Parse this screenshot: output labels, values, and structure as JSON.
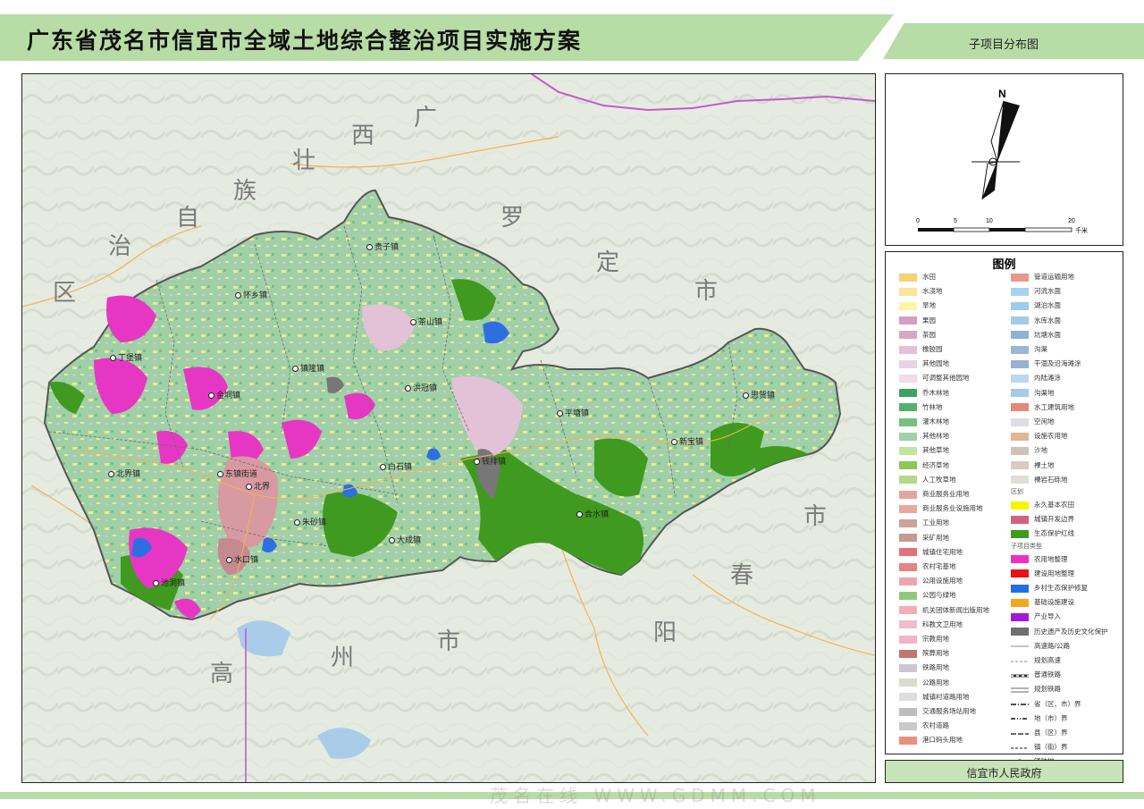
{
  "header": {
    "title": "广东省茂名市信宜市全域土地综合整治项目实施方案",
    "subtitle": "子项目分布图"
  },
  "map": {
    "province_labels": [
      {
        "text": "广"
      },
      {
        "text": "西"
      },
      {
        "text": "壮"
      },
      {
        "text": "族"
      },
      {
        "text": "自"
      },
      {
        "text": "治"
      },
      {
        "text": "区"
      },
      {
        "text": "罗"
      },
      {
        "text": "定"
      },
      {
        "text": "市"
      },
      {
        "text": "市"
      },
      {
        "text": "春"
      },
      {
        "text": "阳"
      },
      {
        "text": "市"
      },
      {
        "text": "州"
      },
      {
        "text": "高"
      }
    ],
    "towns": [
      {
        "name": "钱排镇"
      },
      {
        "name": "合水镇"
      },
      {
        "name": "白石镇"
      },
      {
        "name": "洪冠镇"
      },
      {
        "name": "金垌镇"
      },
      {
        "name": "北界镇"
      },
      {
        "name": "怀乡镇"
      },
      {
        "name": "新宝镇"
      },
      {
        "name": "茶山镇"
      },
      {
        "name": "平塘镇"
      },
      {
        "name": "贵子镇"
      },
      {
        "name": "思贺镇"
      },
      {
        "name": "东镇街道"
      },
      {
        "name": "丁堡镇"
      },
      {
        "name": "朱砂镇"
      },
      {
        "name": "水口镇"
      },
      {
        "name": "镇隆镇"
      },
      {
        "name": "大成镇"
      },
      {
        "name": "池洞镇"
      },
      {
        "name": "北界"
      }
    ],
    "colors": {
      "background": "#e7ece4",
      "forest": "#9fd0a8",
      "protected": "#3f9a1f",
      "farmland": "#f2e88c",
      "reclaim": "#e637c4",
      "urban": "#d79aa0",
      "water": "#2e6fe0",
      "mining": "#777777",
      "road": "#f5b253",
      "boundary": "#6a6a6a",
      "province_road": "#c45ac9"
    }
  },
  "compass": {
    "north_label": "N",
    "scale_labels": [
      "0",
      "5",
      "10",
      "20"
    ],
    "scale_unit": "千米"
  },
  "legend": {
    "title": "图例",
    "left_items": [
      {
        "label": "水田",
        "color": "#f6cf78"
      },
      {
        "label": "水浇地",
        "color": "#fbe49c"
      },
      {
        "label": "旱地",
        "color": "#fcf4a8"
      },
      {
        "label": "果园",
        "color": "#d59fc4"
      },
      {
        "label": "茶园",
        "color": "#d8a7c2"
      },
      {
        "label": "橡胶园",
        "color": "#e3c2d8"
      },
      {
        "label": "其他园地",
        "color": "#ead1e4"
      },
      {
        "label": "可调整其他园地",
        "color": "#f0dcea"
      },
      {
        "label": "乔木林地",
        "color": "#3aa360"
      },
      {
        "label": "竹林地",
        "color": "#56b06c"
      },
      {
        "label": "灌木林地",
        "color": "#78c081"
      },
      {
        "label": "其他林地",
        "color": "#9fd0a8"
      },
      {
        "label": "其他草地",
        "color": "#c4e4a1"
      },
      {
        "label": "经济草地",
        "color": "#8fc85a"
      },
      {
        "label": "人工牧草地",
        "color": "#b2d98b"
      },
      {
        "label": "商业服务业用地",
        "color": "#e3a69c"
      },
      {
        "label": "商业服务业设施用地",
        "color": "#e8a89d"
      },
      {
        "label": "工业用地",
        "color": "#caa49c"
      },
      {
        "label": "采矿用地",
        "color": "#c69a90"
      },
      {
        "label": "城镇住宅用地",
        "color": "#e2737a"
      },
      {
        "label": "农村宅基地",
        "color": "#e5857d"
      },
      {
        "label": "公用设施用地",
        "color": "#eda5ad"
      },
      {
        "label": "公园与绿地",
        "color": "#8fc97b"
      },
      {
        "label": "机关团体新闻出版用地",
        "color": "#f1aeb8"
      },
      {
        "label": "科教文卫用地",
        "color": "#f0bccb"
      },
      {
        "label": "宗教用地",
        "color": "#f2b4c6"
      },
      {
        "label": "殡葬用地",
        "color": "#c0776f"
      },
      {
        "label": "铁路用地",
        "color": "#cec4d3"
      },
      {
        "label": "公路用地",
        "color": "#d7dccd"
      },
      {
        "label": "城镇村道路用地",
        "color": "#dedede"
      },
      {
        "label": "交通服务场站用地",
        "color": "#bdbdbd"
      },
      {
        "label": "农村道路",
        "color": "#c9c9c9"
      },
      {
        "label": "港口码头用地",
        "color": "#e9907e"
      }
    ],
    "right_items": [
      {
        "label": "管道运输用地",
        "color": "#e9988e"
      },
      {
        "label": "河流水面",
        "color": "#a8d3f0"
      },
      {
        "label": "湖泊水面",
        "color": "#9ccbf0"
      },
      {
        "label": "水库水面",
        "color": "#a4cbe8"
      },
      {
        "label": "坑塘水面",
        "color": "#8db2d6"
      },
      {
        "label": "沟渠",
        "color": "#9bb6d6"
      },
      {
        "label": "干涸及沿海滩涂",
        "color": "#9ab1cf"
      },
      {
        "label": "内陆滩涂",
        "color": "#bcd7ee"
      },
      {
        "label": "沟渠地",
        "color": "#a8c9e8"
      },
      {
        "label": "水工建筑用地",
        "color": "#e3897a"
      },
      {
        "label": "空闲地",
        "color": "#dddde6"
      },
      {
        "label": "设施农用地",
        "color": "#ddb891"
      },
      {
        "label": "沙地",
        "color": "#cfc3b9"
      },
      {
        "label": "裸土地",
        "color": "#d9cbc1"
      },
      {
        "label": "裸岩石砾地",
        "color": "#e1ddd7"
      }
    ],
    "section_basic": "区划",
    "basic_items": [
      {
        "label": "永久基本农田",
        "color": "#f6f500"
      },
      {
        "label": "城镇开发边界",
        "color": "#d3617f"
      },
      {
        "label": "生态保护红线",
        "color": "#3f9a1f"
      }
    ],
    "section_project": "子项目类型",
    "project_items": [
      {
        "label": "农用地整理",
        "color": "#f02ec6"
      },
      {
        "label": "建设用地整理",
        "color": "#ee1111"
      },
      {
        "label": "乡村生态保护修复",
        "color": "#1e6fe8"
      },
      {
        "label": "基础设施建设",
        "color": "#f5a61e"
      },
      {
        "label": "产业导入",
        "color": "#a319d6"
      },
      {
        "label": "历史遗产及历史文化保护",
        "color": "#6f6f6f"
      }
    ],
    "line_items": [
      {
        "label": "高速路/公路",
        "style": "solid-thin"
      },
      {
        "label": "规划高速",
        "style": "dashed"
      },
      {
        "label": "普通铁路",
        "style": "rail"
      },
      {
        "label": "规划铁路",
        "style": "double"
      },
      {
        "label": "省（区、市）界",
        "style": "dash-dot"
      },
      {
        "label": "地（市）界",
        "style": "dash-dot-dot"
      },
      {
        "label": "县（区）界",
        "style": "dash-long"
      },
      {
        "label": "镇（街）界",
        "style": "dash-short"
      },
      {
        "label": "镇驻地",
        "style": "dot"
      }
    ]
  },
  "footer": {
    "organization": "信宜市人民政府",
    "watermark": "茂名在线 WWW.GDMM.COM"
  }
}
